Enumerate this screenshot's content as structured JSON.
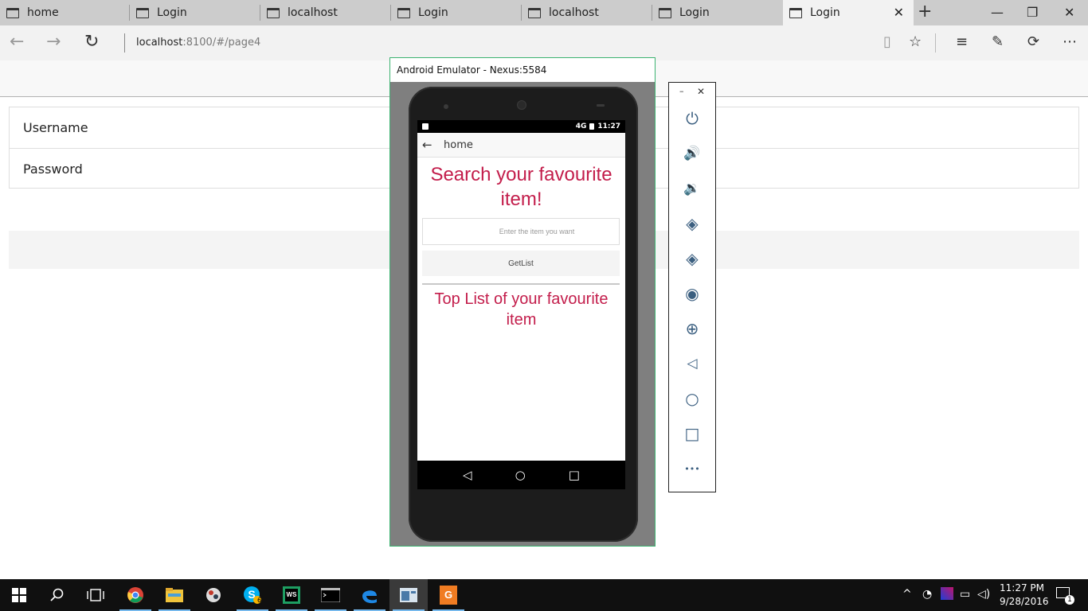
{
  "browser": {
    "tabs": [
      {
        "label": "home"
      },
      {
        "label": "Login"
      },
      {
        "label": "localhost"
      },
      {
        "label": "Login"
      },
      {
        "label": "localhost"
      },
      {
        "label": "Login"
      },
      {
        "label": "Login",
        "active": true
      }
    ],
    "tab_close": "✕",
    "new_tab": "+",
    "window": {
      "minimize": "—",
      "restore": "❐",
      "close": "✕"
    },
    "nav": {
      "back": "←",
      "forward": "→",
      "refresh": "↻"
    },
    "url": {
      "host": "localhost",
      "path": ":8100/#/page4"
    },
    "tools": {
      "reading_view": "▯",
      "favorite": "☆",
      "hub": "≡",
      "notes": "✎",
      "share": "⟳",
      "more": "⋯"
    }
  },
  "page": {
    "fields": [
      {
        "label": "Username"
      },
      {
        "label": "Password"
      }
    ]
  },
  "emulator": {
    "title": "Android Emulator - Nexus:5584",
    "statusbar": {
      "network": "4G",
      "time": "11:27"
    },
    "app": {
      "back_icon": "←",
      "toolbar_title": "home",
      "headline": "Search your favourite item!",
      "input_placeholder": "Enter the item you want",
      "button_label": "GetList",
      "subheading": "Top List of your favourite item"
    },
    "nav_buttons": {
      "back": "◁",
      "home": "○",
      "recents": "□"
    },
    "side_toolbar": {
      "minimize": "–",
      "close": "✕",
      "buttons": [
        {
          "icon": "power-icon",
          "glyph": "⏻"
        },
        {
          "icon": "volume-up-icon",
          "glyph": "🔊"
        },
        {
          "icon": "volume-down-icon",
          "glyph": "🔉"
        },
        {
          "icon": "rotate-left-icon",
          "glyph": "◈"
        },
        {
          "icon": "rotate-right-icon",
          "glyph": "◈"
        },
        {
          "icon": "camera-icon",
          "glyph": "◉"
        },
        {
          "icon": "zoom-icon",
          "glyph": "⊕"
        },
        {
          "icon": "back-icon",
          "glyph": "◁"
        },
        {
          "icon": "home-icon",
          "glyph": "○"
        },
        {
          "icon": "overview-icon",
          "glyph": "□"
        },
        {
          "icon": "more-icon",
          "glyph": "•••"
        }
      ]
    }
  },
  "taskbar": {
    "apps": [
      {
        "name": "chrome-icon",
        "color": "#e8453c"
      },
      {
        "name": "file-explorer-icon",
        "color": "#f0c43c"
      },
      {
        "name": "app-icon",
        "color": "#cccccc"
      },
      {
        "name": "skype-icon",
        "color": "#00aff0",
        "badge": "6"
      },
      {
        "name": "webstorm-icon",
        "color": "#1e9e62"
      },
      {
        "name": "cmd-icon",
        "color": "#222222"
      },
      {
        "name": "edge-icon",
        "color": "#1e88e5"
      },
      {
        "name": "emulator-app-icon",
        "color": "#7fa0c0"
      },
      {
        "name": "pdf-app-icon",
        "color": "#f07c22"
      }
    ],
    "clock": {
      "time": "11:27 PM",
      "date": "9/28/2016"
    },
    "notification_count": "1"
  }
}
